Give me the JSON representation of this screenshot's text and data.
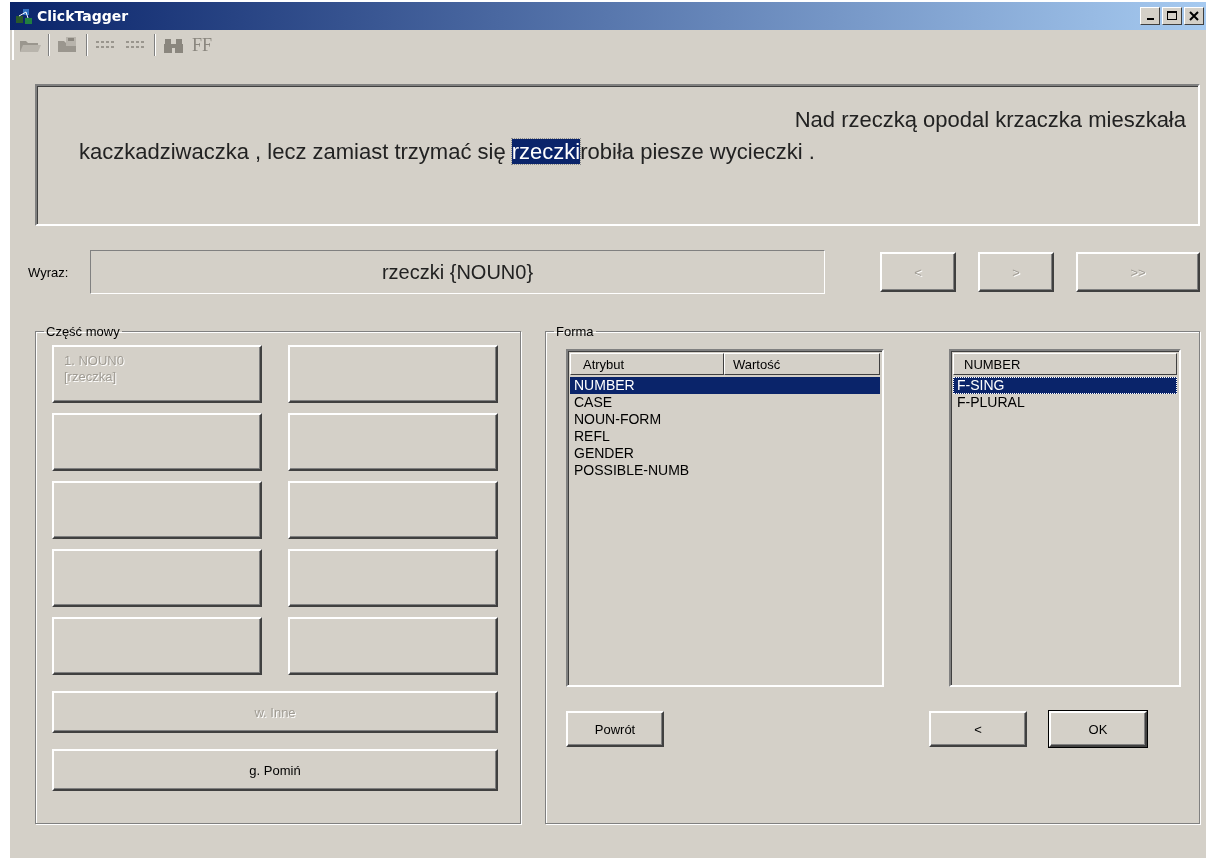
{
  "window": {
    "title": "ClickTagger"
  },
  "toolbar": [
    {
      "kind": "open"
    },
    {
      "kind": "sep"
    },
    {
      "kind": "save"
    },
    {
      "kind": "sep"
    },
    {
      "kind": "dots"
    },
    {
      "kind": "dots"
    },
    {
      "kind": "sep"
    },
    {
      "kind": "find"
    },
    {
      "kind": "font",
      "label": "FF"
    }
  ],
  "sentence": {
    "lines": [
      {
        "kind": "first",
        "tokens": [
          {
            "text": "Nad rzeczką opodal krzaczka mieszkała",
            "selected": false
          }
        ]
      },
      {
        "kind": "wrap",
        "tokens": [
          {
            "text": "kaczkadziwaczka , lecz zamiast trzymać się ",
            "selected": false
          },
          {
            "text": "rzeczki",
            "selected": true
          },
          {
            "text": "robiła piesze wycieczki .",
            "selected": false
          }
        ]
      }
    ]
  },
  "word": {
    "label": "Wyraz:",
    "value": "rzeczki {NOUN0}"
  },
  "nav_buttons": [
    {
      "label": "<",
      "disabled": true
    },
    {
      "label": ">",
      "disabled": true
    },
    {
      "label": ">>",
      "disabled": true
    }
  ],
  "part_of_speech": {
    "title": "Część mowy",
    "buttons": [
      {
        "kind": "word",
        "lines": [
          "1. NOUN0",
          "[rzeczka]"
        ],
        "disabled": true
      },
      {
        "kind": "empty"
      },
      {
        "kind": "empty"
      },
      {
        "kind": "empty"
      },
      {
        "kind": "empty"
      },
      {
        "kind": "empty"
      },
      {
        "kind": "empty"
      },
      {
        "kind": "empty"
      },
      {
        "kind": "empty"
      },
      {
        "kind": "empty"
      }
    ],
    "other_button": {
      "label": "w. Inne",
      "disabled": true
    },
    "skip_button": {
      "label": "g. Pomiń",
      "disabled": false
    }
  },
  "form": {
    "title": "Forma",
    "attributes": {
      "columns": [
        "Atrybut",
        "Wartość"
      ],
      "rows": [
        {
          "name": "NUMBER",
          "selected": true
        },
        {
          "name": "CASE",
          "selected": false
        },
        {
          "name": "NOUN-FORM",
          "selected": false
        },
        {
          "name": "REFL",
          "selected": false
        },
        {
          "name": "GENDER",
          "selected": false
        },
        {
          "name": "POSSIBLE-NUMB",
          "selected": false
        }
      ]
    },
    "values": {
      "header": "NUMBER",
      "items": [
        {
          "label": "F-SING",
          "selected": true
        },
        {
          "label": "F-PLURAL",
          "selected": false
        }
      ]
    },
    "back_button": {
      "label": "Powrót"
    },
    "prev_button": {
      "label": "<"
    },
    "ok_button": {
      "label": "OK"
    }
  }
}
